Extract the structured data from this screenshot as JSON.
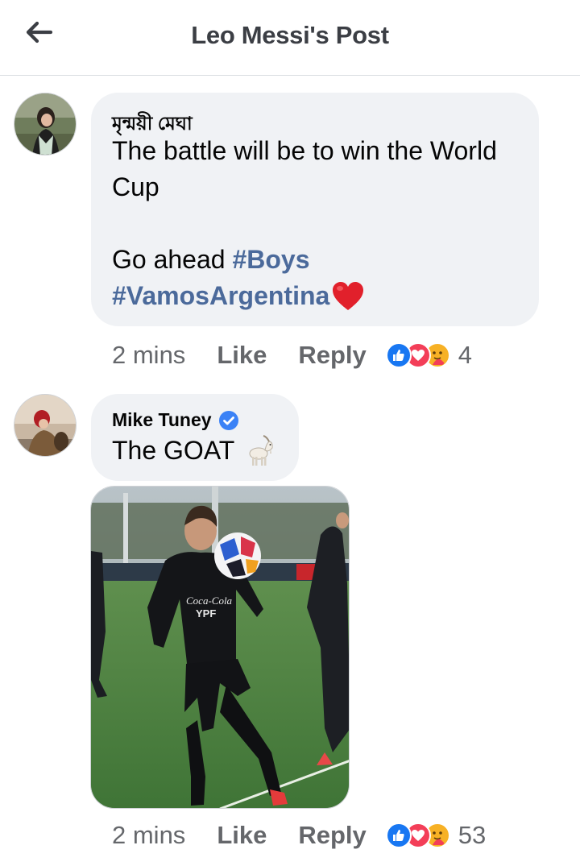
{
  "header": {
    "title": "Leo Messi's Post"
  },
  "comments": [
    {
      "author": "মৃন্ময়ী মেঘা",
      "line1": "The battle will be to win the World",
      "line2": "Cup",
      "line3_text": "Go ahead ",
      "hashtag1": "#Boys",
      "hashtag2": "#VamosArgentina",
      "time": "2 mins",
      "like_label": "Like",
      "reply_label": "Reply",
      "reaction_count": "4"
    },
    {
      "author": "Mike Tuney",
      "text": "The GOAT",
      "verified": true,
      "time": "2 mins",
      "like_label": "Like",
      "reply_label": "Reply",
      "reaction_count": "53"
    }
  ],
  "icons": {
    "back": "arrow-left-icon",
    "verified": "verified-badge-icon",
    "heart": "red-heart-emoji",
    "goat": "goat-emoji",
    "like": "like-reaction-icon",
    "love": "love-reaction-icon",
    "care": "care-reaction-icon"
  },
  "colors": {
    "hashtag": "#4b6a9b",
    "bubble": "#f0f2f5",
    "like_blue": "#1877f2",
    "love_red": "#f33e58",
    "care_yellow": "#f7b125",
    "verified_blue": "#3b82f6"
  }
}
